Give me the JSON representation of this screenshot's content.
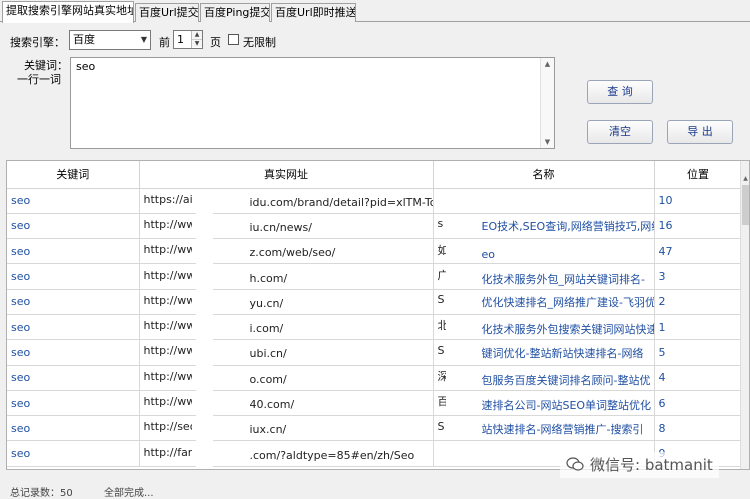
{
  "tabs": [
    {
      "label": "提取搜索引擎网站真实地址",
      "active": true
    },
    {
      "label": "百度Url提交",
      "active": false
    },
    {
      "label": "百度Ping提交",
      "active": false
    },
    {
      "label": "百度Url即时推送",
      "active": false
    }
  ],
  "form": {
    "engine_label": "搜索引擎：",
    "engine_value": "百度",
    "front_label": "前",
    "pages_value": "1",
    "pages_label": "页",
    "unlimited_label": "无限制",
    "keyword_label_line1": "关键词：",
    "keyword_label_line2": "一行一词",
    "keyword_value": "seo"
  },
  "buttons": {
    "query": "查 询",
    "clear": "清空",
    "export": "导 出"
  },
  "table": {
    "headers": [
      "关键词",
      "真实网址",
      "名称",
      "位置"
    ],
    "rows": [
      [
        "seo",
        "https://aiq",
        "idu.com/brand/detail?pid=xlTM-TogKuTv",
        "",
        "",
        "10"
      ],
      [
        "seo",
        "http://www",
        "iu.cn/news/",
        "s",
        "EO技术,SEO查询,网络营销技巧,网络",
        "16"
      ],
      [
        "seo",
        "http://www",
        "z.com/web/seo/",
        "如",
        "eo",
        "47"
      ],
      [
        "seo",
        "http://www",
        "h.com/",
        "广",
        "化技术服务外包_网站关键词排名-",
        "3"
      ],
      [
        "seo",
        "http://www",
        "yu.cn/",
        "S",
        "优化快速排名_网络推广建设-飞羽优",
        "2"
      ],
      [
        "seo",
        "http://www",
        "i.com/",
        "北",
        "化技术服务外包搜索关键词网站快速",
        "1"
      ],
      [
        "seo",
        "http://www",
        "ubi.cn/",
        "S",
        "键词优化-整站新站快速排名-网络",
        "5"
      ],
      [
        "seo",
        "http://www",
        "o.com/",
        "深",
        "包服务百度关键词排名顾问-整站优",
        "4"
      ],
      [
        "seo",
        "http://www",
        "40.com/",
        "百",
        "速排名公司-网站SEO单词整站优化",
        "6"
      ],
      [
        "seo",
        "http://seo",
        "iux.cn/",
        "S",
        "站快速排名-网络营销推广-搜索引",
        "8"
      ],
      [
        "seo",
        "http://fany",
        ".com/?aldtype=85#en/zh/Seo",
        "",
        "",
        "9"
      ]
    ]
  },
  "status": {
    "total": "总记录数：50",
    "done": "全部完成..."
  },
  "watermark": "微信号: batmanit"
}
